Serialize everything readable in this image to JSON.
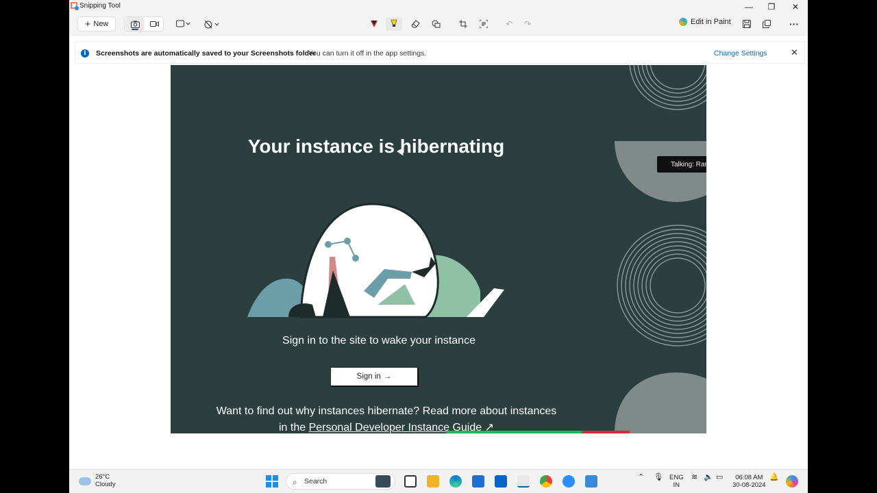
{
  "window": {
    "title": "Snipping Tool"
  },
  "toolbar": {
    "new_label": "New",
    "edit_paint_label": "Edit in Paint"
  },
  "banner": {
    "title": "Screenshots are automatically saved to your Screenshots folder",
    "subtitle": "You can turn it off in the app settings.",
    "link": "Change Settings"
  },
  "screenshot": {
    "hero_title": "Your instance is hibernating",
    "wake_text": "Sign in to the site to wake your instance",
    "signin_label": "Sign in",
    "signin_arrow": "→",
    "more_text": "Want to find out why instances hibernate? Read more about instances in the",
    "more_link": "Personal Developer Instance Guide",
    "more_link_icon": "↗",
    "talking_label": "Talking: Ran"
  },
  "taskbar": {
    "weather_temp": "26°C",
    "weather_desc": "Cloudy",
    "search_placeholder": "Search",
    "lang_1": "ENG",
    "lang_2": "IN",
    "time": "06:08 AM",
    "date": "30-08-2024"
  },
  "colors": {
    "canvas_bg": "#2b3f3f",
    "accent": "#0067c0"
  }
}
